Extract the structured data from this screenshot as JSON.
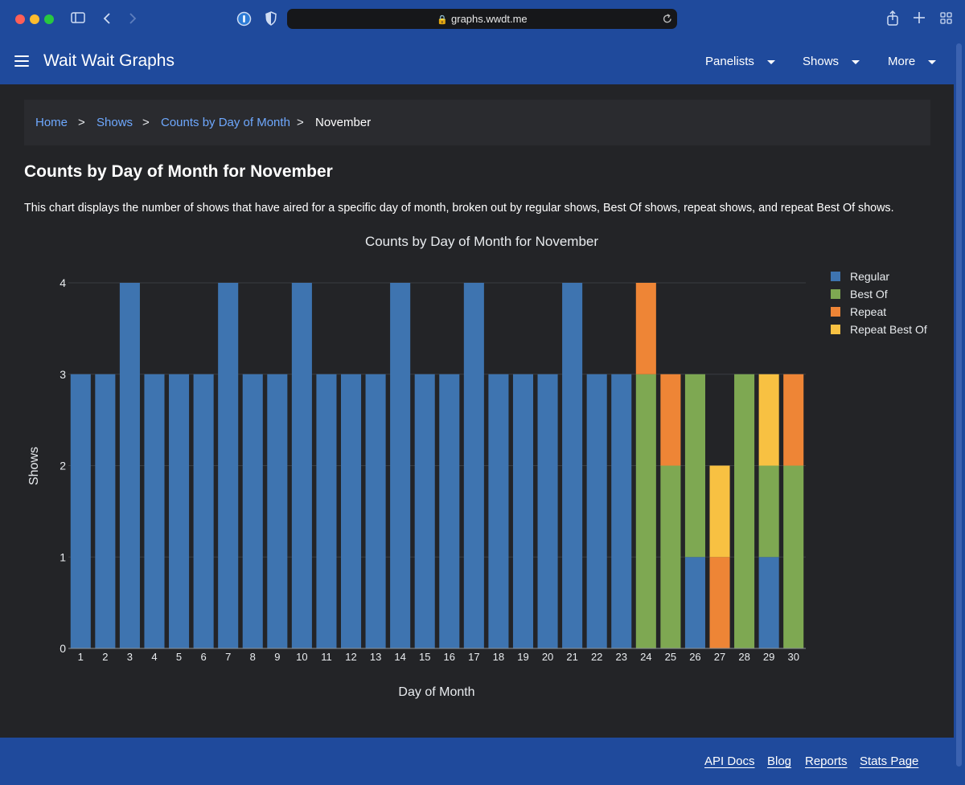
{
  "browser": {
    "url": "graphs.wwdt.me",
    "traffic_lights": [
      "#ff5f57",
      "#febc2e",
      "#28c840"
    ]
  },
  "navbar": {
    "brand": "Wait Wait Graphs",
    "items": [
      {
        "label": "Panelists"
      },
      {
        "label": "Shows"
      },
      {
        "label": "More"
      }
    ]
  },
  "breadcrumb": {
    "items": [
      "Home",
      "Shows",
      "Counts by Day of Month"
    ],
    "current": "November",
    "separator": ">"
  },
  "page": {
    "title": "Counts by Day of Month for November",
    "description": "This chart displays the number of shows that have aired for a specific day of month, broken out by regular shows, Best Of shows, repeat shows, and repeat Best Of shows."
  },
  "chart_data": {
    "type": "bar",
    "stacked": true,
    "title": "Counts by Day of Month for November",
    "xlabel": "Day of Month",
    "ylabel": "Shows",
    "ylim": [
      0,
      4
    ],
    "yticks": [
      0,
      1,
      2,
      3,
      4
    ],
    "grid": true,
    "legend_position": "top-right",
    "categories": [
      "1",
      "2",
      "3",
      "4",
      "5",
      "6",
      "7",
      "8",
      "9",
      "10",
      "11",
      "12",
      "13",
      "14",
      "15",
      "16",
      "17",
      "18",
      "19",
      "20",
      "21",
      "22",
      "23",
      "24",
      "25",
      "26",
      "27",
      "28",
      "29",
      "30"
    ],
    "series": [
      {
        "name": "Regular",
        "color": "#3e74b0",
        "values": [
          3,
          3,
          4,
          3,
          3,
          3,
          4,
          3,
          3,
          4,
          3,
          3,
          3,
          4,
          3,
          3,
          4,
          3,
          3,
          3,
          4,
          3,
          3,
          0,
          0,
          1,
          0,
          0,
          1,
          0
        ]
      },
      {
        "name": "Best Of",
        "color": "#7ea852",
        "values": [
          0,
          0,
          0,
          0,
          0,
          0,
          0,
          0,
          0,
          0,
          0,
          0,
          0,
          0,
          0,
          0,
          0,
          0,
          0,
          0,
          0,
          0,
          0,
          3,
          2,
          2,
          0,
          3,
          1,
          2
        ]
      },
      {
        "name": "Repeat",
        "color": "#ee8536",
        "values": [
          0,
          0,
          0,
          0,
          0,
          0,
          0,
          0,
          0,
          0,
          0,
          0,
          0,
          0,
          0,
          0,
          0,
          0,
          0,
          0,
          0,
          0,
          0,
          1,
          1,
          0,
          1,
          0,
          0,
          1
        ]
      },
      {
        "name": "Repeat Best Of",
        "color": "#f8c142",
        "values": [
          0,
          0,
          0,
          0,
          0,
          0,
          0,
          0,
          0,
          0,
          0,
          0,
          0,
          0,
          0,
          0,
          0,
          0,
          0,
          0,
          0,
          0,
          0,
          0,
          0,
          0,
          1,
          0,
          1,
          0
        ]
      }
    ]
  },
  "footer": {
    "links": [
      "API Docs",
      "Blog",
      "Reports",
      "Stats Page"
    ]
  }
}
